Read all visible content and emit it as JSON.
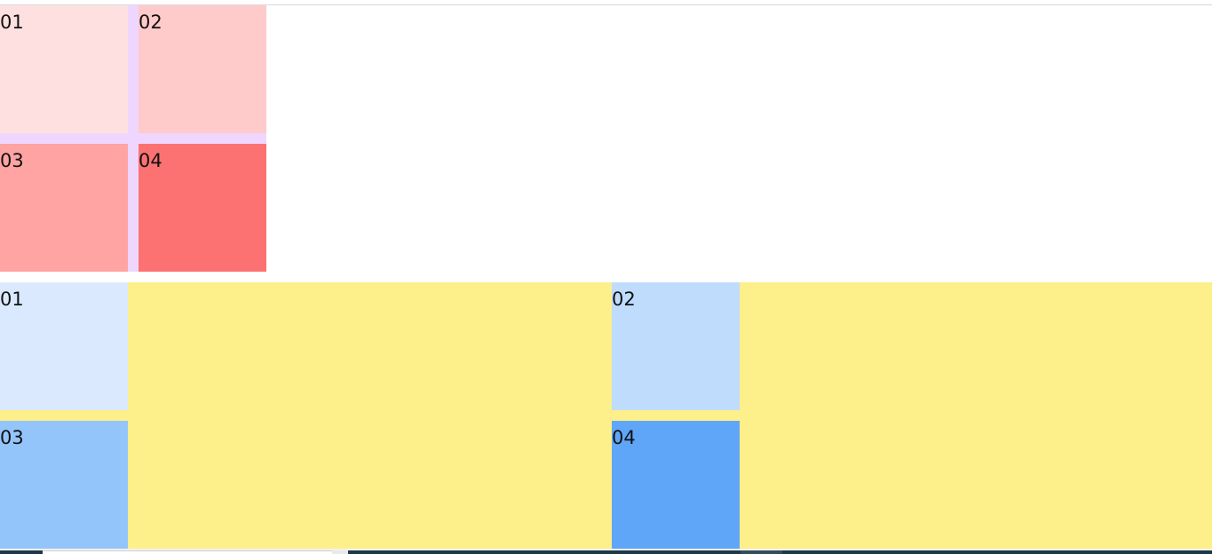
{
  "grid_top": {
    "cells": [
      {
        "label": "01",
        "color": "#ffe0e0"
      },
      {
        "label": "02",
        "color": "#ffcaca"
      },
      {
        "label": "03",
        "color": "#ffa3a3"
      },
      {
        "label": "04",
        "color": "#fc7272"
      }
    ],
    "gap_color": "#eed6ff"
  },
  "grid_bottom": {
    "cells": [
      {
        "label": "01",
        "color": "#dbe9ff"
      },
      {
        "label": "02",
        "color": "#bfdcfd"
      },
      {
        "label": "03",
        "color": "#93c5fb"
      },
      {
        "label": "04",
        "color": "#60a6f8"
      }
    ],
    "background_color": "#fdef8a"
  }
}
